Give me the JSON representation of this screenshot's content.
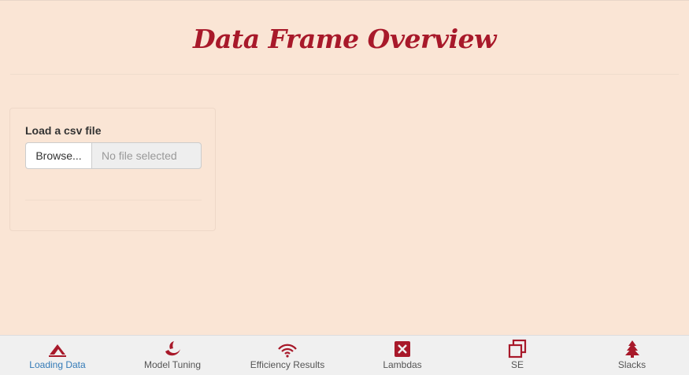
{
  "header": {
    "title": "Data Frame Overview"
  },
  "file_input": {
    "label": "Load a csv file",
    "browse_label": "Browse...",
    "placeholder": "No file selected"
  },
  "nav": {
    "active_index": 0,
    "items": [
      {
        "label": "Loading Data",
        "icon": "mountain-icon",
        "active": true
      },
      {
        "label": "Model Tuning",
        "icon": "tuning-swirl-icon",
        "active": false
      },
      {
        "label": "Efficiency Results",
        "icon": "wifi-icon",
        "active": false
      },
      {
        "label": "Lambdas",
        "icon": "square-x-icon",
        "active": false
      },
      {
        "label": "SE",
        "icon": "copy-squares-icon",
        "active": false
      },
      {
        "label": "Slacks",
        "icon": "tree-icon",
        "active": false
      }
    ]
  },
  "colors": {
    "background": "#fae5d5",
    "accent": "#a8192a",
    "active_link": "#337ab7"
  }
}
